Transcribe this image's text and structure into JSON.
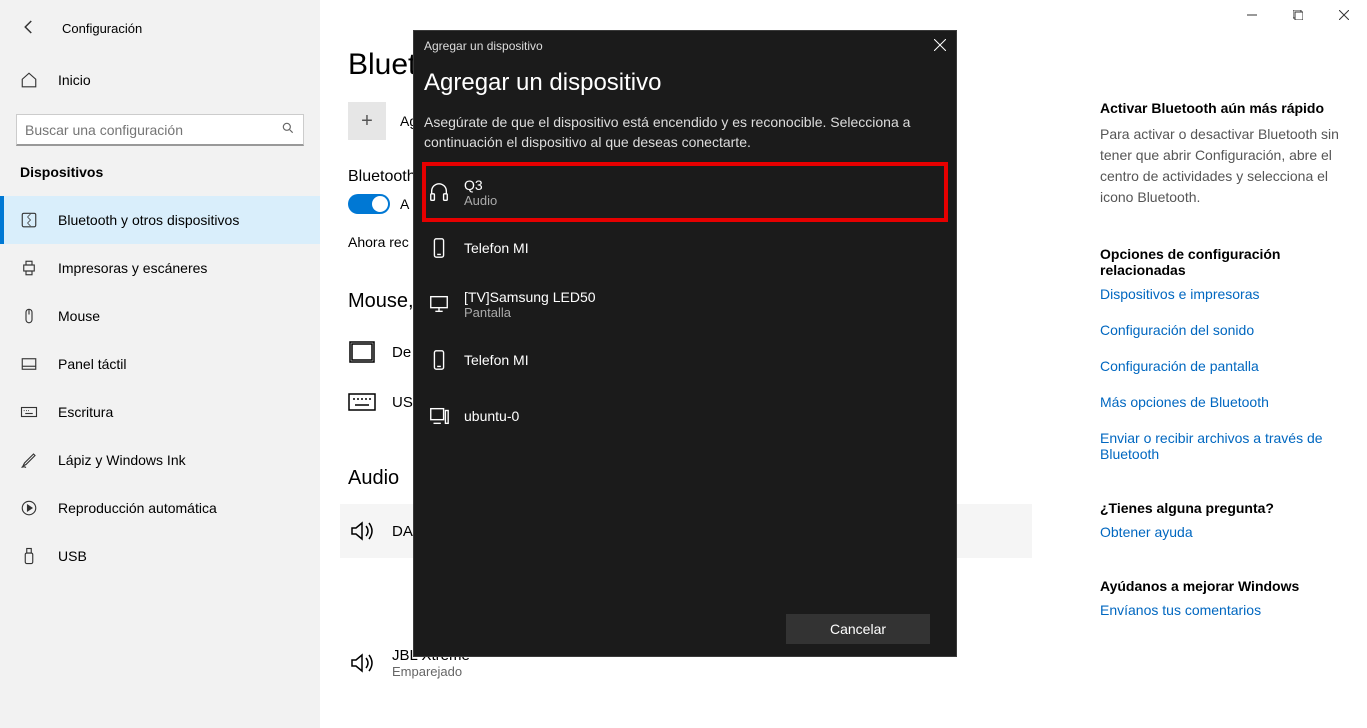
{
  "app_title": "Configuración",
  "home_label": "Inicio",
  "search_placeholder": "Buscar una configuración",
  "section_label": "Dispositivos",
  "nav": [
    {
      "label": "Bluetooth y otros dispositivos",
      "selected": true,
      "icon": "bluetooth"
    },
    {
      "label": "Impresoras y escáneres",
      "selected": false,
      "icon": "printer"
    },
    {
      "label": "Mouse",
      "selected": false,
      "icon": "mouse"
    },
    {
      "label": "Panel táctil",
      "selected": false,
      "icon": "touchpad"
    },
    {
      "label": "Escritura",
      "selected": false,
      "icon": "keyboard"
    },
    {
      "label": "Lápiz y Windows Ink",
      "selected": false,
      "icon": "pen"
    },
    {
      "label": "Reproducción automática",
      "selected": false,
      "icon": "autoplay"
    },
    {
      "label": "USB",
      "selected": false,
      "icon": "usb"
    }
  ],
  "main": {
    "page_heading_partial": "Bluet",
    "add_partial": "Ag",
    "bluetooth_label_partial": "Bluetooth",
    "toggle_partial": "A",
    "discoverable_partial": "Ahora rec",
    "mouse_section_partial": "Mouse,",
    "device_de_partial": "De",
    "device_us_partial": "US",
    "audio_section": "Audio",
    "device_da_partial": "DA",
    "jbl_name": "JBL Xtreme",
    "jbl_status": "Emparejado"
  },
  "info": {
    "tip_heading": "Activar Bluetooth aún más rápido",
    "tip_text": "Para activar o desactivar Bluetooth sin tener que abrir Configuración, abre el centro de actividades y selecciona el icono Bluetooth.",
    "related_heading": "Opciones de configuración relacionadas",
    "links": [
      "Dispositivos e impresoras",
      "Configuración del sonido",
      "Configuración de pantalla",
      "Más opciones de Bluetooth",
      "Enviar o recibir archivos a través de Bluetooth"
    ],
    "help_heading": "¿Tienes alguna pregunta?",
    "help_link": "Obtener ayuda",
    "improve_heading": "Ayúdanos a mejorar Windows",
    "improve_link": "Envíanos tus comentarios"
  },
  "dialog": {
    "titlebar": "Agregar un dispositivo",
    "heading": "Agregar un dispositivo",
    "subtext": "Asegúrate de que el dispositivo está encendido y es reconocible. Selecciona a continuación el dispositivo al que deseas conectarte.",
    "devices": [
      {
        "name": "Q3",
        "sub": "Audio",
        "icon": "headset",
        "highlight": true
      },
      {
        "name": "Telefon MI",
        "sub": "",
        "icon": "phone",
        "highlight": false
      },
      {
        "name": "[TV]Samsung LED50",
        "sub": "Pantalla",
        "icon": "monitor",
        "highlight": false
      },
      {
        "name": "Telefon MI",
        "sub": "",
        "icon": "phone",
        "highlight": false
      },
      {
        "name": "ubuntu-0",
        "sub": "",
        "icon": "desktop",
        "highlight": false
      }
    ],
    "cancel": "Cancelar"
  }
}
